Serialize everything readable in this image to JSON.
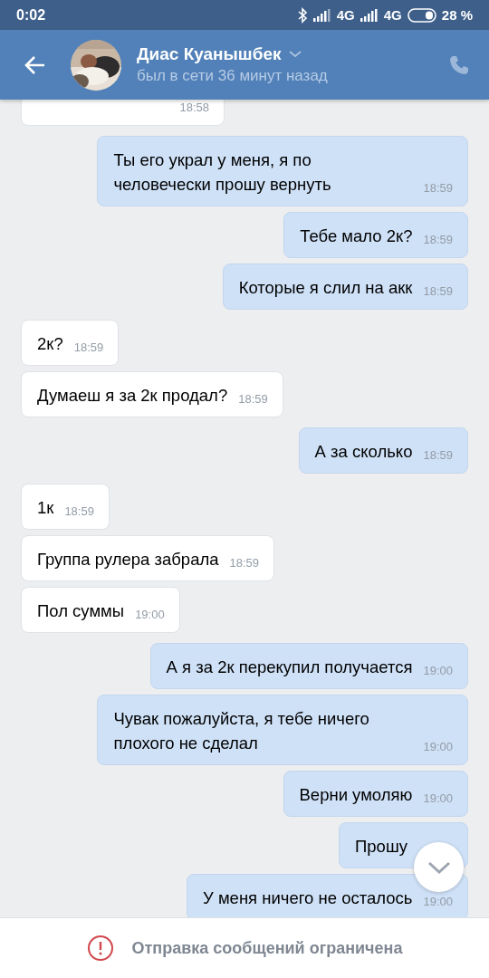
{
  "status_bar": {
    "time": "0:02",
    "network_1": "4G",
    "network_2": "4G",
    "battery": "28 %"
  },
  "header": {
    "name": "Диас Куанышбек",
    "status": "был в сети 36 минут назад"
  },
  "messages": [
    {
      "outgoing": false,
      "time": "18:58"
    },
    {
      "outgoing": true,
      "text": "Ты его украл у меня, я по человечески прошу вернуть",
      "time": "18:59"
    },
    {
      "outgoing": true,
      "text": "Тебе мало 2к?",
      "time": "18:59"
    },
    {
      "outgoing": true,
      "text": "Которые я слил на акк",
      "time": "18:59"
    },
    {
      "outgoing": false,
      "text": "2к?",
      "time": "18:59"
    },
    {
      "outgoing": false,
      "text": "Думаеш я за 2к продал?",
      "time": "18:59"
    },
    {
      "outgoing": true,
      "text": "А за сколько",
      "time": "18:59"
    },
    {
      "outgoing": false,
      "text": "1к",
      "time": "18:59"
    },
    {
      "outgoing": false,
      "text": "Группа рулера забрала",
      "time": "18:59"
    },
    {
      "outgoing": false,
      "text": "Пол суммы",
      "time": "19:00"
    },
    {
      "outgoing": true,
      "text": "А я за 2к перекупил получается",
      "time": "19:00"
    },
    {
      "outgoing": true,
      "text": "Чувак пожалуйста, я тебе ничего плохого не сделал",
      "time": "19:00"
    },
    {
      "outgoing": true,
      "text": "Верни умоляю",
      "time": "19:00"
    },
    {
      "outgoing": true,
      "text": "Прошу"
    },
    {
      "outgoing": true,
      "text": "У меня ничего не осталось",
      "time": "19:00"
    }
  ],
  "footer": {
    "notice": "Отправка сообщений ограничена"
  }
}
